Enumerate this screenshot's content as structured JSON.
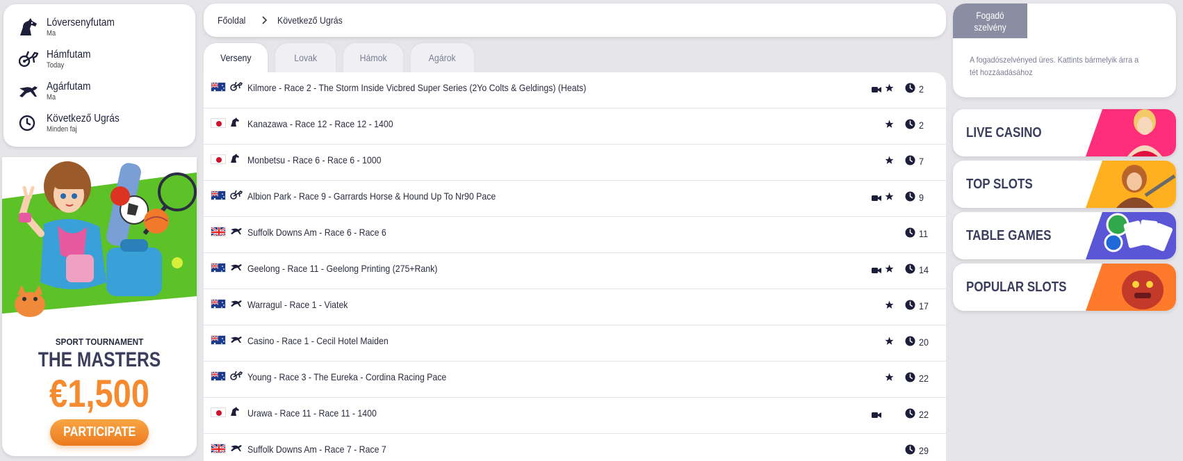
{
  "sports_menu": [
    {
      "name": "Lóversenyfutam",
      "sub": "Ma",
      "icon": "horse-head-icon"
    },
    {
      "name": "Hámfutam",
      "sub": "Today",
      "icon": "harness-cart-icon"
    },
    {
      "name": "Agárfutam",
      "sub": "Ma",
      "icon": "greyhound-icon"
    },
    {
      "name": "Következő Ugrás",
      "sub": "Minden faj",
      "icon": "clock-icon"
    }
  ],
  "promo": {
    "tag": "SPORT TOURNAMENT",
    "title": "THE MASTERS",
    "amount": "€1,500",
    "button": "PARTICIPATE",
    "colors": {
      "green": "#5cc227",
      "orange": "#f58a2e"
    }
  },
  "breadcrumb": {
    "home": "Főoldal",
    "current": "Következő Ugrás"
  },
  "tabs": [
    "Verseny",
    "Lovak",
    "Hámok",
    "Agárok"
  ],
  "races": [
    {
      "flag": "au",
      "type": "harness",
      "name": "Kilmore - Race 2 - The Storm Inside Vicbred Super Series (2Yo Colts & Geldings) (Heats)",
      "video": true,
      "fav": true,
      "mins": "2"
    },
    {
      "flag": "jp",
      "type": "horse",
      "name": "Kanazawa - Race 12 - Race 12 - 1400",
      "video": false,
      "fav": true,
      "mins": "2"
    },
    {
      "flag": "jp",
      "type": "horse",
      "name": "Monbetsu - Race 6 - Race 6 - 1000",
      "video": false,
      "fav": true,
      "mins": "7"
    },
    {
      "flag": "au",
      "type": "harness",
      "name": "Albion Park - Race 9 - Garrards Horse & Hound Up To Nr90 Pace",
      "video": true,
      "fav": true,
      "mins": "9"
    },
    {
      "flag": "gb",
      "type": "greyhound",
      "name": "Suffolk Downs Am - Race 6 - Race 6",
      "video": false,
      "fav": false,
      "mins": "11"
    },
    {
      "flag": "au",
      "type": "greyhound",
      "name": "Geelong - Race 11 - Geelong Printing (275+Rank)",
      "video": true,
      "fav": true,
      "mins": "14"
    },
    {
      "flag": "au",
      "type": "greyhound",
      "name": "Warragul - Race 1 - Viatek",
      "video": false,
      "fav": true,
      "mins": "17"
    },
    {
      "flag": "au",
      "type": "greyhound",
      "name": "Casino - Race 1 - Cecil Hotel Maiden",
      "video": false,
      "fav": true,
      "mins": "20"
    },
    {
      "flag": "au",
      "type": "harness",
      "name": "Young - Race 3 - The Eureka - Cordina Racing Pace",
      "video": false,
      "fav": true,
      "mins": "22"
    },
    {
      "flag": "jp",
      "type": "horse",
      "name": "Urawa - Race 11 - Race 11 - 1400",
      "video": true,
      "fav": false,
      "mins": "22"
    },
    {
      "flag": "gb",
      "type": "greyhound",
      "name": "Suffolk Downs Am - Race 7 - Race 7",
      "video": false,
      "fav": false,
      "mins": "29"
    }
  ],
  "betslip": {
    "title_line1": "Fogadó",
    "title_line2": "szelvény",
    "message_line1": "A fogadószelvényed üres. Kattints bármelyik árra a",
    "message_line2": "tét hozzáadásához"
  },
  "casino_links": [
    {
      "label": "LIVE CASINO",
      "accent": "#ff2e7a"
    },
    {
      "label": "TOP SLOTS",
      "accent": "#ffb020"
    },
    {
      "label": "TABLE GAMES",
      "accent": "#5a56d6"
    },
    {
      "label": "POPULAR SLOTS",
      "accent": "#ff7a2a"
    }
  ]
}
